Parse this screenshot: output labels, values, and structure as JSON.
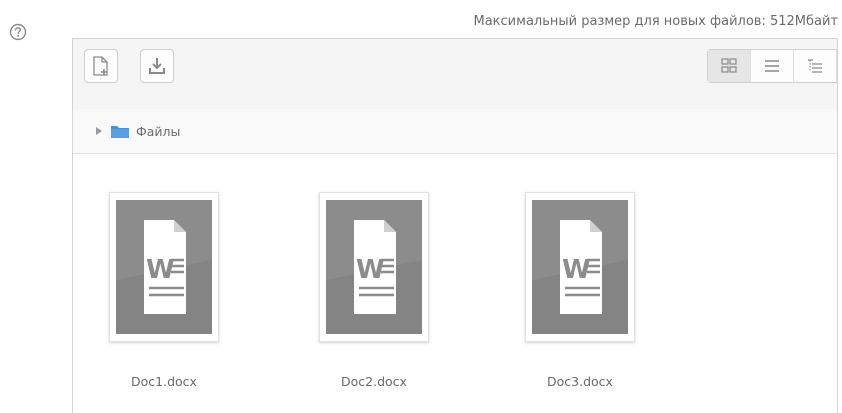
{
  "header": {
    "max_size_text": "Максимальный размер для новых файлов: 512Мбайт"
  },
  "toolbar": {
    "add_icon": "file-add-icon",
    "download_icon": "download-icon",
    "views": [
      {
        "icon": "grid-view-icon",
        "active": true
      },
      {
        "icon": "list-view-icon",
        "active": false
      },
      {
        "icon": "tree-view-icon",
        "active": false
      }
    ]
  },
  "path": {
    "folder_label": "Файлы"
  },
  "files": [
    {
      "name": "Doc1.docx",
      "icon": "word-document-icon"
    },
    {
      "name": "Doc2.docx",
      "icon": "word-document-icon"
    },
    {
      "name": "Doc3.docx",
      "icon": "word-document-icon"
    }
  ],
  "colors": {
    "folder": "#4a8fd6",
    "doc_icon_bg": "#8c8c8c",
    "toolbar_bg": "#f5f5f5"
  }
}
